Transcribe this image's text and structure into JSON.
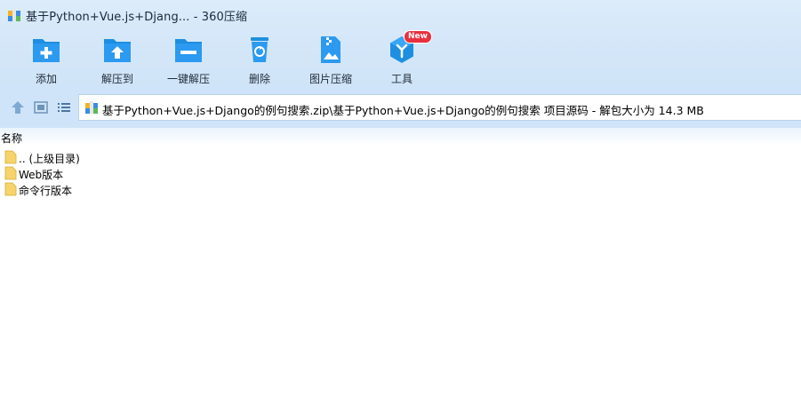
{
  "window": {
    "title": "基于Python+Vue.js+Djang... - 360压缩"
  },
  "toolbar": {
    "items": [
      {
        "label": "添加",
        "icon": "add-folder-icon"
      },
      {
        "label": "解压到",
        "icon": "extract-to-icon"
      },
      {
        "label": "一键解压",
        "icon": "one-click-extract-icon"
      },
      {
        "label": "删除",
        "icon": "recycle-bin-icon"
      },
      {
        "label": "图片压缩",
        "icon": "image-compress-icon"
      },
      {
        "label": "工具",
        "icon": "tools-icon",
        "badge": "New"
      }
    ]
  },
  "nav": {
    "path": "基于Python+Vue.js+Django的例句搜索.zip\\基于Python+Vue.js+Django的例句搜索 项目源码 - 解包大小为 14.3 MB"
  },
  "list": {
    "column_name": "名称",
    "rows": [
      {
        "name": ".. (上级目录)",
        "icon": "folder-icon"
      },
      {
        "name": "Web版本",
        "icon": "folder-icon"
      },
      {
        "name": "命令行版本",
        "icon": "folder-icon"
      }
    ]
  },
  "colors": {
    "accent": "#1e8fe0",
    "toolbar_bg": "#d3e6f9",
    "badge": "#e8313f"
  }
}
